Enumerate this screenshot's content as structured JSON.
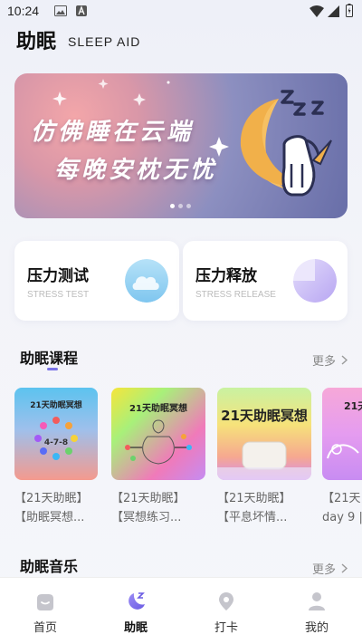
{
  "status_bar": {
    "time": "10:24"
  },
  "header": {
    "title": "助眠",
    "subtitle": "SLEEP AID"
  },
  "banner": {
    "line1": "仿佛睡在云端",
    "line2": "每晚安枕无忧",
    "pages": 3,
    "active_page": 1
  },
  "stress_cards": [
    {
      "title": "压力测试",
      "subtitle": "STRESS TEST",
      "icon": "cloud-icon",
      "icon_color": "#8fd0f3"
    },
    {
      "title": "压力释放",
      "subtitle": "STRESS RELEASE",
      "icon": "pie-progress-icon",
      "icon_color": "#c9bdf5"
    }
  ],
  "courses_section": {
    "title": "助眠课程",
    "more_label": "更多",
    "items": [
      {
        "cover_title": "21天助眠冥想",
        "cover_text": "4-7-8",
        "line1": "【21天助眠】",
        "line2": "【助眠冥想..."
      },
      {
        "cover_title": "21天助眠冥想",
        "line1": "【21天助眠】",
        "line2": "【冥想练习..."
      },
      {
        "cover_title": "21天助眠冥想",
        "line1": "【21天助眠】",
        "line2": "【平息坏情..."
      },
      {
        "cover_title": "21天",
        "line1": "【21天",
        "line2": "day 9 |"
      }
    ]
  },
  "music_section": {
    "title": "助眠音乐",
    "more_label": "更多"
  },
  "bottom_nav": {
    "items": [
      {
        "label": "首页",
        "icon": "home-icon"
      },
      {
        "label": "助眠",
        "icon": "moon-sleep-icon",
        "active": true
      },
      {
        "label": "打卡",
        "icon": "location-pin-icon"
      },
      {
        "label": "我的",
        "icon": "person-icon"
      }
    ]
  },
  "colors": {
    "accent": "#7b74e8",
    "banner_start": "#f3a6a9",
    "banner_end": "#686ea8"
  }
}
